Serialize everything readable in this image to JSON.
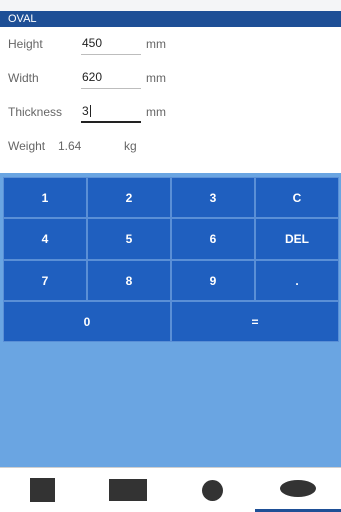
{
  "titlebar": {
    "title": "OVAL"
  },
  "form": {
    "height": {
      "label": "Height",
      "value": "450",
      "unit": "mm"
    },
    "width": {
      "label": "Width",
      "value": "620",
      "unit": "mm"
    },
    "thickness": {
      "label": "Thickness",
      "value": "3",
      "unit": "mm"
    },
    "weight": {
      "label": "Weight",
      "value": "1.64",
      "unit": "kg"
    }
  },
  "keypad": {
    "k1": "1",
    "k2": "2",
    "k3": "3",
    "clear": "C",
    "k4": "4",
    "k5": "5",
    "k6": "6",
    "del": "DEL",
    "k7": "7",
    "k8": "8",
    "k9": "9",
    "dot": ".",
    "k0": "0",
    "equals": "="
  },
  "colors": {
    "accent": "#1e4f96",
    "key_bg": "#1f5fbf",
    "keypad_bg": "#6aa5e2",
    "shape": "#333333"
  },
  "bottom_tabs": {
    "items": [
      "square-icon",
      "rectangle-icon",
      "circle-icon",
      "oval-icon"
    ],
    "selected": "oval-icon"
  }
}
